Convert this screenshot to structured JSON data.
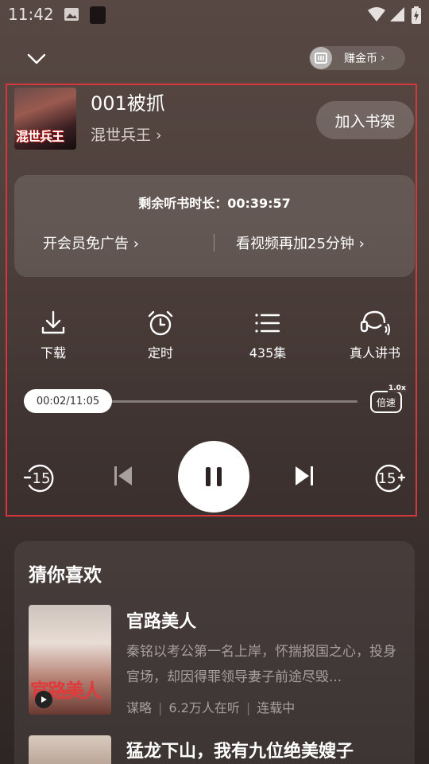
{
  "status_bar": {
    "time": "11:42"
  },
  "top_bar": {
    "coin_label": "赚金币",
    "coin_chevron": "›"
  },
  "now_playing": {
    "cover_text": "混世兵王",
    "chapter_title": "001被抓",
    "book_name": "混世兵王 ›",
    "shelf_button": "加入书架"
  },
  "timer_card": {
    "remaining_text": "剩余听书时长：00:39:57",
    "vip_link": "开会员免广告 ›",
    "video_link": "看视频再加25分钟 ›"
  },
  "actions": [
    {
      "label": "下载",
      "icon": "download-icon"
    },
    {
      "label": "定时",
      "icon": "alarm-clock-icon"
    },
    {
      "label": "435集",
      "icon": "list-icon"
    },
    {
      "label": "真人讲书",
      "icon": "headset-icon"
    }
  ],
  "progress": {
    "time_label": "00:02/11:05",
    "fraction": 0.003
  },
  "speed": {
    "label": "倍速",
    "value": "1.0x"
  },
  "controls": {
    "rewind_seconds": "15",
    "forward_seconds": "15"
  },
  "recommend": {
    "heading": "猜你喜欢",
    "items": [
      {
        "title": "官路美人",
        "cover_text": "官路美人",
        "description": "秦铭以考公第一名上岸，怀揣报国之心，投身官场，却因得罪领导妻子前途尽毁...",
        "meta": [
          "谋略",
          "6.2万人在听",
          "连载中"
        ]
      },
      {
        "title": "猛龙下山，我有九位绝美嫂子"
      }
    ]
  },
  "colors": {
    "frame_red": "#d9363c",
    "background": "#4e403c"
  }
}
